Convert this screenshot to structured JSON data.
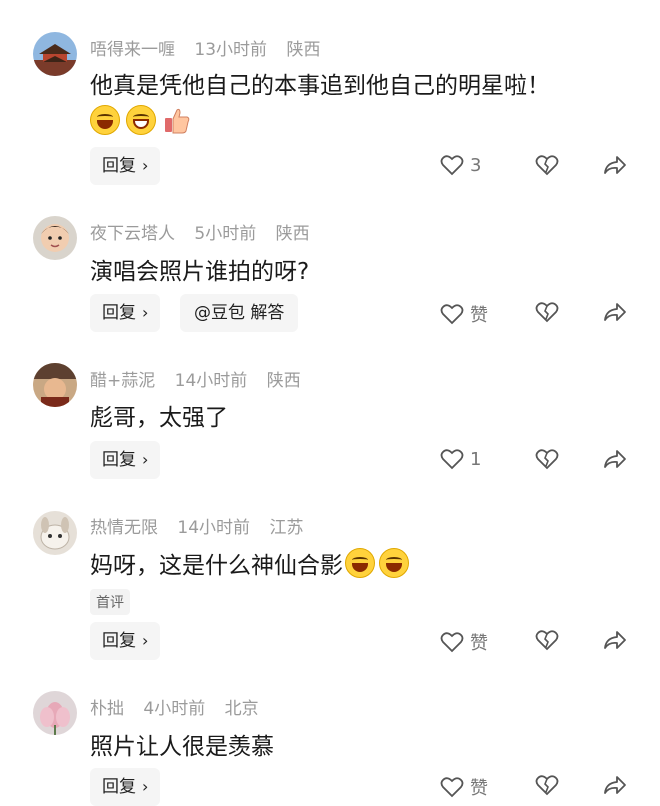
{
  "comments": [
    {
      "author": "唔得来一喱",
      "time": "13小时前",
      "location": "陕西",
      "text": "他真是凭他自己的本事追到他自己的明星啦！",
      "reply": "回复",
      "likes": "3"
    },
    {
      "author": "夜下云塔人",
      "time": "5小时前",
      "location": "陕西",
      "text": "演唱会照片谁拍的呀?",
      "reply": "回复",
      "ask": "@豆包 解答",
      "likes": "赞"
    },
    {
      "author": "醋+蒜泥",
      "time": "14小时前",
      "location": "陕西",
      "text": "彪哥，太强了",
      "reply": "回复",
      "likes": "1"
    },
    {
      "author": "热情无限",
      "time": "14小时前",
      "location": "江苏",
      "text": "妈呀，这是什么神仙合影",
      "badge": "首评",
      "reply": "回复",
      "likes": "赞"
    },
    {
      "author": "朴拙",
      "time": "4小时前",
      "location": "北京",
      "text": "照片让人很是羡慕",
      "reply": "回复",
      "likes": "赞"
    }
  ]
}
